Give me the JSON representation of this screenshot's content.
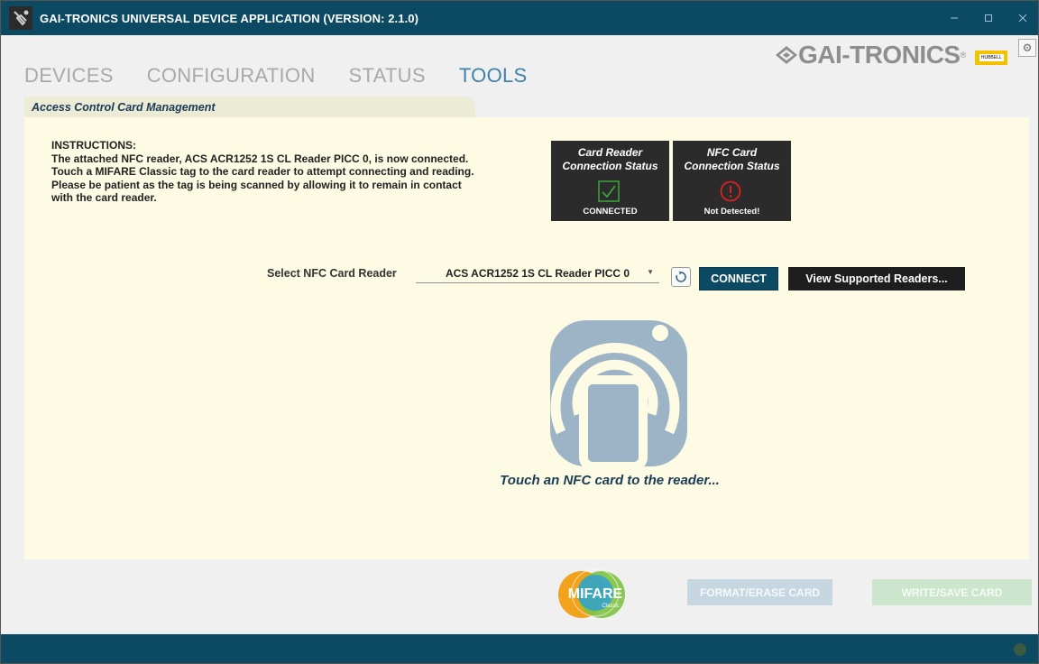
{
  "window": {
    "title": "GAI-TRONICS UNIVERSAL DEVICE APPLICATION (VERSION: 2.1.0)",
    "controls": [
      "minimize",
      "maximize",
      "close"
    ]
  },
  "nav": {
    "items": [
      {
        "label": "DEVICES",
        "active": false
      },
      {
        "label": "CONFIGURATION",
        "active": false
      },
      {
        "label": "STATUS",
        "active": false
      },
      {
        "label": "TOOLS",
        "active": true
      }
    ]
  },
  "logo": {
    "text": "GAI-TRONICS",
    "mark": "®",
    "sub_brand": "HUBBELL"
  },
  "section": {
    "title": "Access Control Card Management"
  },
  "instructions": {
    "heading": "INSTRUCTIONS:",
    "line1": "The attached NFC reader, ACS ACR1252 1S CL Reader PICC 0, is now connected.",
    "line2": "Touch a MIFARE Classic tag to the card reader to attempt connecting and reading.",
    "line3": "Please be patient as the tag is being scanned by allowing it to remain in contact",
    "line4": "with the card reader."
  },
  "status": {
    "card_reader": {
      "line1": "Card Reader",
      "line2": "Connection Status",
      "state": "CONNECTED",
      "icon": "check-icon",
      "color": "#3aa63a"
    },
    "nfc_card": {
      "line1": "NFC Card",
      "line2": "Connection Status",
      "state": "Not Detected!",
      "icon": "alert-icon",
      "color": "#e02020"
    }
  },
  "reader": {
    "label": "Select NFC Card Reader",
    "selected": "ACS ACR1252 1S CL Reader PICC 0",
    "connect_label": "CONNECT",
    "view_label": "View Supported Readers..."
  },
  "prompt": {
    "text": "Touch an NFC card to the reader..."
  },
  "bottom": {
    "mifare_text": "MIFARE",
    "mifare_sub": "Classic",
    "format_label": "FORMAT/ERASE CARD",
    "write_label": "WRITE/SAVE CARD"
  },
  "colors": {
    "brand_dark": "#0c4a63",
    "accent_blue": "#3e82ab",
    "panel_bg": "#fdfbe3",
    "nfc_graphic": "#9db4c6"
  }
}
